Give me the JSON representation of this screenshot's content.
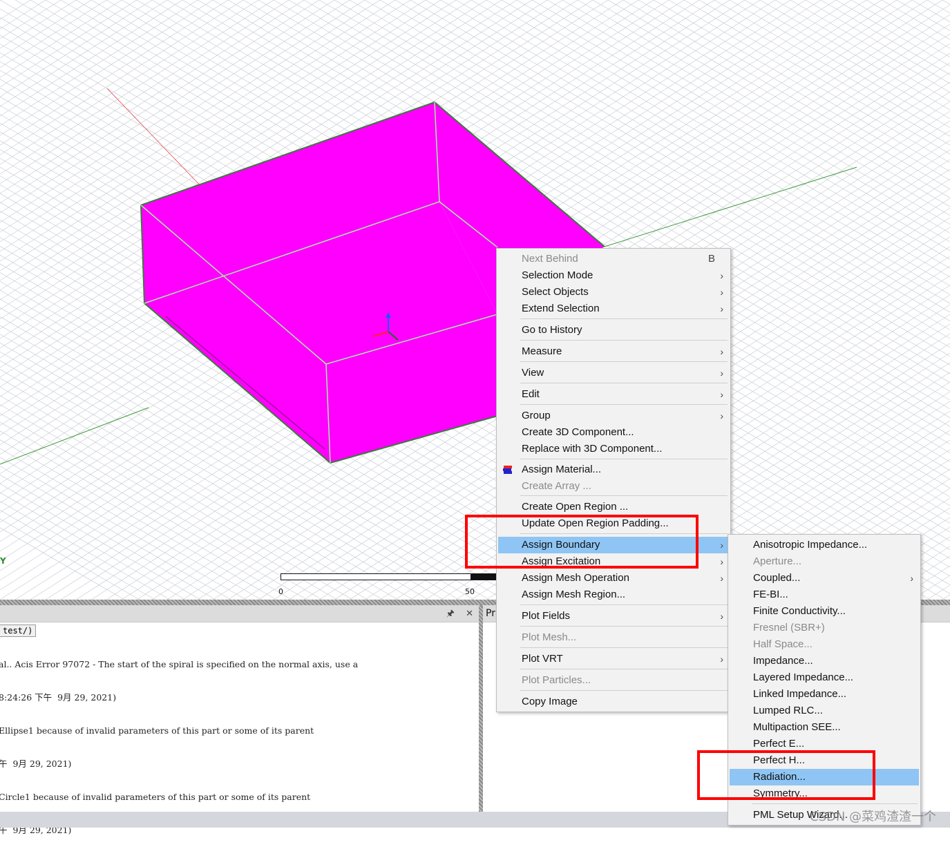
{
  "viewport": {
    "axis_label": "Y",
    "ruler": {
      "start": "0",
      "mid": "50"
    },
    "object_color": "#ff00ff"
  },
  "message_panel": {
    "pin_icon": "pin-icon",
    "close_icon": "close-icon",
    "tab": "test/)",
    "log_lines": [
      "al.. Acis Error 97072 - The start of the spiral is specified on the normal axis, use a",
      "8:24:26 下午  9月 29, 2021)",
      "Ellipse1 because of invalid parameters of this part or some of its parent",
      "午  9月 29, 2021)",
      "Circle1 because of invalid parameters of this part or some of its parent",
      "午  9月 29, 2021)"
    ]
  },
  "properties_panel": {
    "tab": "Pr"
  },
  "context_menu": {
    "items": [
      {
        "label": "Next Behind",
        "shortcut": "B",
        "disabled": true
      },
      {
        "label": "Selection Mode",
        "submenu": true
      },
      {
        "label": "Select Objects",
        "submenu": true
      },
      {
        "label": "Extend Selection",
        "submenu": true
      },
      {
        "label": "Go to History"
      },
      {
        "label": "Measure",
        "submenu": true
      },
      {
        "label": "View",
        "submenu": true
      },
      {
        "label": "Edit",
        "submenu": true
      },
      {
        "label": "Group",
        "submenu": true
      },
      {
        "label": "Create 3D Component..."
      },
      {
        "label": "Replace with 3D Component..."
      },
      {
        "label": "Assign Material...",
        "icon": "material-icon"
      },
      {
        "label": "Create Array ...",
        "disabled": true
      },
      {
        "label": "Create Open Region ..."
      },
      {
        "label": "Update Open Region Padding..."
      },
      {
        "label": "Assign Boundary",
        "submenu": true,
        "highlighted": true
      },
      {
        "label": "Assign Excitation",
        "submenu": true
      },
      {
        "label": "Assign Mesh Operation",
        "submenu": true
      },
      {
        "label": "Assign Mesh Region..."
      },
      {
        "label": "Plot Fields",
        "submenu": true
      },
      {
        "label": "Plot Mesh...",
        "disabled": true
      },
      {
        "label": "Plot VRT",
        "submenu": true
      },
      {
        "label": "Plot Particles...",
        "disabled": true
      },
      {
        "label": "Copy Image"
      }
    ]
  },
  "boundary_submenu": {
    "items": [
      {
        "label": "Anisotropic Impedance..."
      },
      {
        "label": "Aperture...",
        "disabled": true
      },
      {
        "label": "Coupled...",
        "submenu": true
      },
      {
        "label": "FE-BI..."
      },
      {
        "label": "Finite Conductivity..."
      },
      {
        "label": "Fresnel (SBR+)",
        "disabled": true
      },
      {
        "label": "Half Space...",
        "disabled": true
      },
      {
        "label": "Impedance..."
      },
      {
        "label": "Layered Impedance..."
      },
      {
        "label": "Linked Impedance..."
      },
      {
        "label": "Lumped RLC..."
      },
      {
        "label": "Multipaction SEE..."
      },
      {
        "label": "Perfect E..."
      },
      {
        "label": "Perfect H..."
      },
      {
        "label": "Radiation...",
        "highlighted": true
      },
      {
        "label": "Symmetry..."
      },
      {
        "label": "PML Setup Wizard..."
      }
    ]
  },
  "watermark": "CSDN @菜鸡渣渣一个",
  "colors": {
    "highlight": "#8ec5f4",
    "annotation": "#ff0000",
    "menu_bg": "#f2f2f2"
  }
}
